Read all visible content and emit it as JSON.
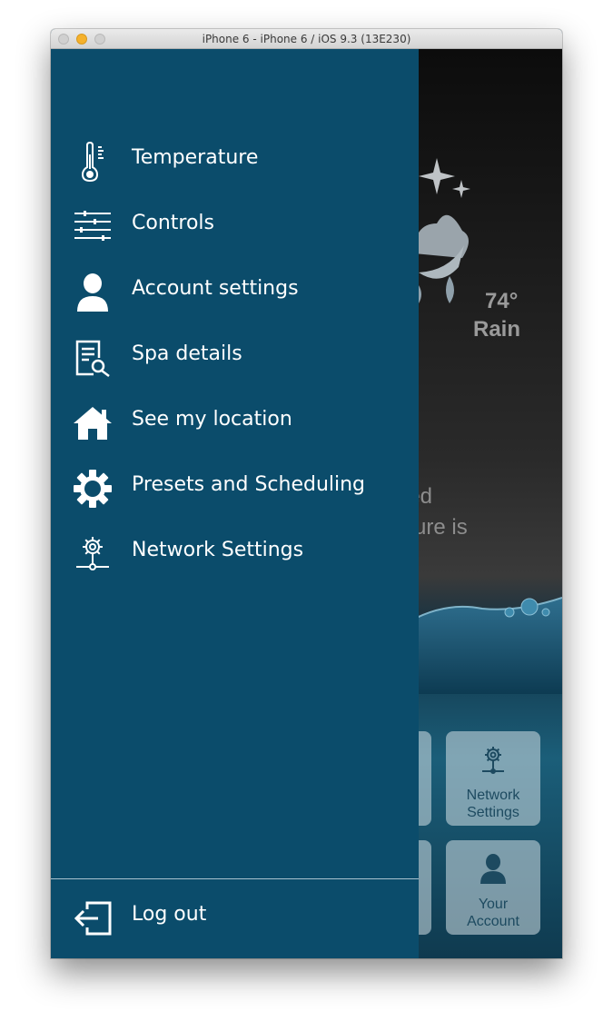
{
  "window": {
    "title": "iPhone 6 - iPhone 6 / iOS 9.3 (13E230)"
  },
  "menu": {
    "items": [
      {
        "label": "Temperature",
        "icon": "thermometer-icon"
      },
      {
        "label": "Controls",
        "icon": "sliders-icon"
      },
      {
        "label": "Account settings",
        "icon": "user-icon"
      },
      {
        "label": "Spa details",
        "icon": "document-search-icon"
      },
      {
        "label": "See my location",
        "icon": "home-icon"
      },
      {
        "label": "Presets and Scheduling",
        "icon": "gear-icon"
      },
      {
        "label": "Network Settings",
        "icon": "network-gear-icon"
      }
    ],
    "logout": {
      "label": "Log out",
      "icon": "logout-icon"
    }
  },
  "background": {
    "weather": {
      "temperature": "74°",
      "condition": "Rain",
      "icon": "night-rain-icon"
    },
    "message": "ired\nature is\n.",
    "tiles": [
      {
        "label": "Network\nSettings",
        "icon": "network-gear-icon"
      },
      {
        "label": "Your\nAccount",
        "icon": "user-icon"
      }
    ]
  },
  "colors": {
    "drawer_background": "#0b4c6b",
    "menu_text": "#ffffff",
    "divider": "#a9c2cf"
  }
}
